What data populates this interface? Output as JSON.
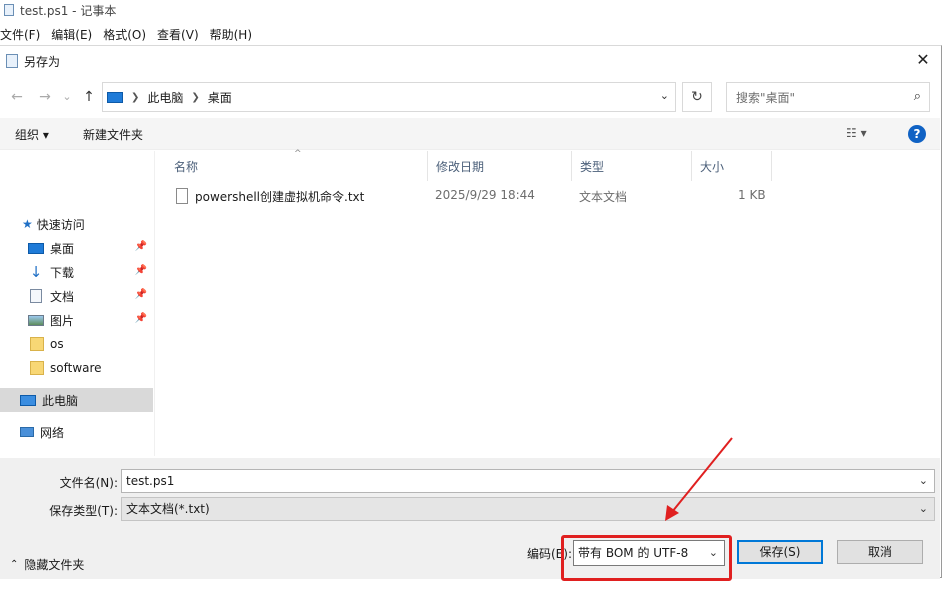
{
  "notepad": {
    "title": "test.ps1 - 记事本",
    "menu": [
      "文件(F)",
      "编辑(E)",
      "格式(O)",
      "查看(V)",
      "帮助(H)"
    ]
  },
  "dialog": {
    "title": "另存为",
    "close_glyph": "✕",
    "nav": {
      "back": "←",
      "forward": "→",
      "recent": "⌄",
      "up": "↑"
    },
    "address": {
      "crumbs": [
        "此电脑",
        "桌面"
      ],
      "refresh_glyph": "↻",
      "dropdown_glyph": "⌄"
    },
    "search": {
      "placeholder": "搜索\"桌面\"",
      "icon_glyph": "⌕"
    },
    "toolbar": {
      "organize": "组织 ▾",
      "new_folder": "新建文件夹",
      "view_glyph": "☷ ▾",
      "help_glyph": "?"
    },
    "sidebar": [
      {
        "label": "快速访问",
        "icon": "star-icon",
        "pinned": false
      },
      {
        "label": "桌面",
        "icon": "desktop-icon",
        "pinned": true
      },
      {
        "label": "下载",
        "icon": "download-icon",
        "pinned": true
      },
      {
        "label": "文档",
        "icon": "document-icon",
        "pinned": true
      },
      {
        "label": "图片",
        "icon": "picture-icon",
        "pinned": true
      },
      {
        "label": "os",
        "icon": "folder-icon",
        "pinned": false
      },
      {
        "label": "software",
        "icon": "folder-icon",
        "pinned": false
      },
      {
        "label": "此电脑",
        "icon": "computer-icon",
        "pinned": false,
        "selected": true
      },
      {
        "label": "网络",
        "icon": "network-icon",
        "pinned": false
      }
    ],
    "columns": {
      "name": "名称",
      "modified": "修改日期",
      "type": "类型",
      "size": "大小"
    },
    "files": [
      {
        "name": "powershell创建虚拟机命令.txt",
        "modified": "2025/9/29 18:44",
        "type": "文本文档",
        "size": "1 KB"
      }
    ],
    "form": {
      "filename_label": "文件名(N):",
      "filename_value": "test.ps1",
      "filetype_label": "保存类型(T):",
      "filetype_value": "文本文档(*.txt)",
      "hide_folders": "隐藏文件夹",
      "encoding_label": "编码(E):",
      "encoding_value": "带有 BOM 的 UTF-8",
      "save": "保存(S)",
      "cancel": "取消"
    },
    "colors": {
      "annotation": "#e02020",
      "accent": "#0078d7"
    }
  }
}
